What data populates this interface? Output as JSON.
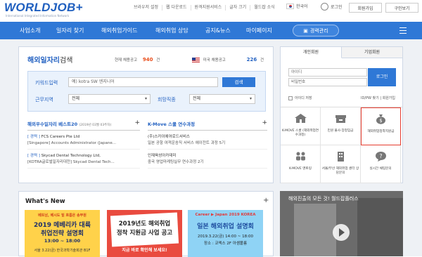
{
  "header": {
    "logo_text": "WORLDJOB+",
    "logo_tagline": "International Integrated Information Network",
    "utility_links": [
      "브라우저 설정",
      "웹 다운로드",
      "원격지원서비스",
      "글자 크기",
      "월드잡 소식"
    ],
    "language": "한국어",
    "login": "로그인",
    "buttons": [
      "회원가입",
      "구인보기"
    ]
  },
  "nav": {
    "items": [
      "사업소개",
      "일자리 찾기",
      "해외취업가이드",
      "해외취업 상담",
      "공지&뉴스",
      "마이페이지"
    ],
    "career_button": "경력관리"
  },
  "search": {
    "title_main": "해외일자리",
    "title_sub": "검색",
    "stat1_label": "현재 채용공고",
    "stat1_value": "940",
    "stat1_unit": "건",
    "stat2_label": "미국 채용공고",
    "stat2_value": "226",
    "stat2_unit": "건",
    "keyword_label": "키워드입력",
    "keyword_placeholder": "예) kotra SW 엔지니어",
    "search_button": "검색",
    "region_label": "근무지역",
    "region_value": "전체",
    "job_label": "희망직종",
    "job_value": "전체"
  },
  "best": {
    "title": "해외우수일자리 베스트20",
    "date": "(2019년 03월 03주차)",
    "entries": [
      {
        "tag": "[ 경력 ]",
        "company": "FCS Careers Pte Ltd",
        "detail": "[Singapore] Accounts Administrator (Japane..."
      },
      {
        "tag": "[ 경력 ]",
        "company": "Skycad Dental Technology Ltd,",
        "detail": "[KOTRA글로벌일자리대전] Skycad Dental Tech..."
      }
    ]
  },
  "kmove": {
    "title": "K-Move 스쿨 연수과정",
    "entries": [
      {
        "company": "(주)스카이에어로드서비스",
        "detail": "일본 공항 여객운송직 서비스 에이전트 과정 5기"
      },
      {
        "company": "인재육성아카데미",
        "detail": "중국 영업마케팅실무 연수과정 2기"
      }
    ]
  },
  "member": {
    "tabs": [
      "개인회원",
      "기업회원"
    ],
    "id_placeholder": "아이디",
    "pw_placeholder": "비밀번호",
    "login_button": "로그인",
    "save_id": "아이디 저장",
    "find": "ID/PW 찾기 | 회원가입",
    "services": [
      "K-MOVE 스쿨 (해외취업연수과정)",
      "민원 불사·장정임금",
      "해외취업정착지원금",
      "K-MOVE 멘토링",
      "서울/부산 해외취업 센터 상담문의",
      "실시간 채팅문의"
    ]
  },
  "news": {
    "title": "What's New",
    "thumbs": [
      {
        "top": "베트남, 베시도 밑 흐름은 송부원",
        "main1": "2019 메베리카 대륙",
        "main2": "취업전략 설명회",
        "sub": "13:00 ~ 18:00",
        "foot": "서울 3.22(금) 한국과학기술회관 B1F"
      },
      {
        "main1": "2019년도 해외취업",
        "main2": "정착 지원금 사업 공고",
        "sub": "지금 바로 확인해 보세요!"
      },
      {
        "top": "Career ▶ Japan 2019 KOREA",
        "main1": "일본 해외취업 설명회",
        "sub": "2019.3.22(금) 14:00 ~ 18:00",
        "foot": "장소 : 코엑스 2F 아셈볼룸"
      }
    ]
  },
  "video": {
    "title": "해외진출의 모든 것! 월드잡플러스"
  },
  "colors": {
    "primary": "#2f78d6",
    "accent": "#e94e1b",
    "highlight": "#e63c2e"
  }
}
